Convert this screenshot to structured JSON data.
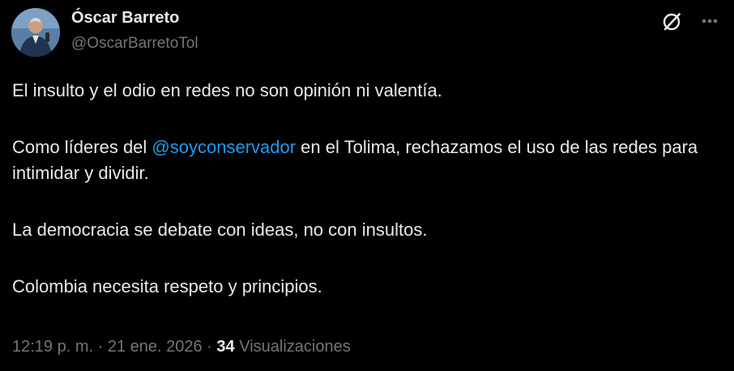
{
  "author": {
    "name": "Óscar Barreto",
    "handle": "@OscarBarretoTol",
    "avatar_icon": "profile-photo"
  },
  "header_icons": {
    "grok": "grok-icon",
    "more": "more-options-icon"
  },
  "tweet": {
    "line1": "El insulto y el odio en redes no son opinión ni valentía.",
    "line2_pre": "Como líderes del ",
    "line2_mention": "@soyconservador",
    "line2_post": " en el Tolima, rechazamos el uso de las redes para intimidar y dividir.",
    "line3": "La democracia se debate con ideas, no con insultos.",
    "line4": "Colombia necesita respeto y principios."
  },
  "meta": {
    "time": "12:19 p. m.",
    "sep1": " · ",
    "date": "21 ene. 2026",
    "sep2": " · ",
    "views_count": "34",
    "views_label": " Visualizaciones"
  },
  "colors": {
    "background": "#000000",
    "text": "#e7e9ea",
    "muted": "#71767b",
    "link": "#1d9bf0"
  }
}
